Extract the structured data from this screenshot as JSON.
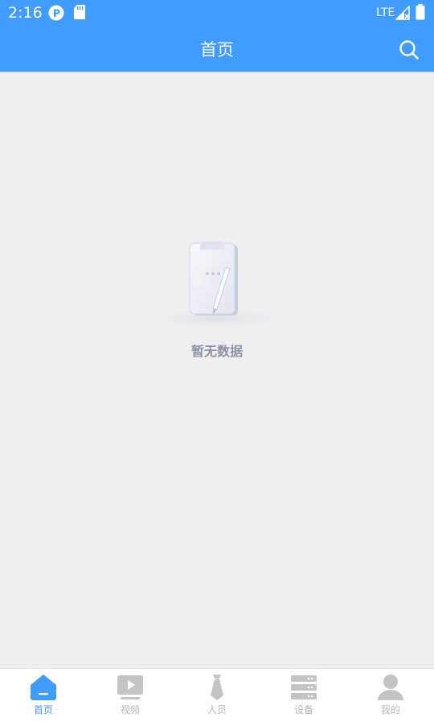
{
  "status_bar": {
    "time": "2:16",
    "network": "LTE",
    "icons": [
      "notification-app-icon",
      "sd-card-icon",
      "signal-icon",
      "battery-icon"
    ]
  },
  "header": {
    "title": "首页",
    "search_icon": "search-icon"
  },
  "empty_state": {
    "icon": "empty-clipboard-icon",
    "message": "暂无数据"
  },
  "tab_bar": {
    "active_color": "#409cfe",
    "inactive_color": "#b7b7b7",
    "tabs": [
      {
        "label": "首页",
        "icon": "home-icon",
        "active": true
      },
      {
        "label": "视频",
        "icon": "video-icon",
        "active": false
      },
      {
        "label": "人员",
        "icon": "person-tie-icon",
        "active": false
      },
      {
        "label": "设备",
        "icon": "server-icon",
        "active": false
      },
      {
        "label": "我的",
        "icon": "user-icon",
        "active": false
      }
    ]
  },
  "colors": {
    "brand": "#409cfe",
    "background": "#efefef"
  }
}
